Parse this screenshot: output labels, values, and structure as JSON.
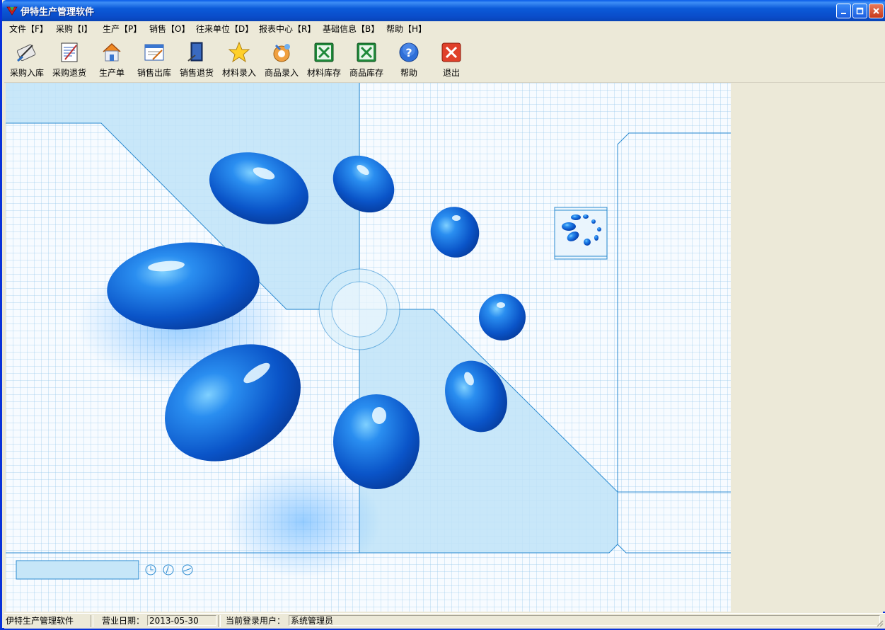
{
  "window": {
    "title": "伊特生产管理软件"
  },
  "menu": [
    {
      "label": "文件【F】"
    },
    {
      "label": "采购【I】"
    },
    {
      "label": "生产【P】"
    },
    {
      "label": "销售【O】"
    },
    {
      "label": "往来单位【D】"
    },
    {
      "label": "报表中心【R】"
    },
    {
      "label": "基础信息【B】"
    },
    {
      "label": "帮助【H】"
    }
  ],
  "toolbar": [
    {
      "label": "采购入库",
      "icon": "purchase-in-icon"
    },
    {
      "label": "采购退货",
      "icon": "purchase-return-icon"
    },
    {
      "label": "生产单",
      "icon": "production-order-icon"
    },
    {
      "label": "销售出库",
      "icon": "sales-out-icon"
    },
    {
      "label": "销售退货",
      "icon": "sales-return-icon"
    },
    {
      "label": "材料录入",
      "icon": "star-icon"
    },
    {
      "label": "商品录入",
      "icon": "goods-entry-icon"
    },
    {
      "label": "材料库存",
      "icon": "excel-icon"
    },
    {
      "label": "商品库存",
      "icon": "excel-icon"
    },
    {
      "label": "帮助",
      "icon": "help-icon"
    },
    {
      "label": "退出",
      "icon": "exit-icon"
    }
  ],
  "statusbar": {
    "app_name": "伊特生产管理软件",
    "date_label": "营业日期：",
    "date_value": "2013-05-30",
    "user_label": "当前登录用户：",
    "user_value": "系统管理员"
  },
  "colors": {
    "title_bar": "#0a5ce8",
    "accent_blue": "#1a6fd8",
    "client_bg": "#f7fbff",
    "panel_bg": "#ece9d8"
  }
}
